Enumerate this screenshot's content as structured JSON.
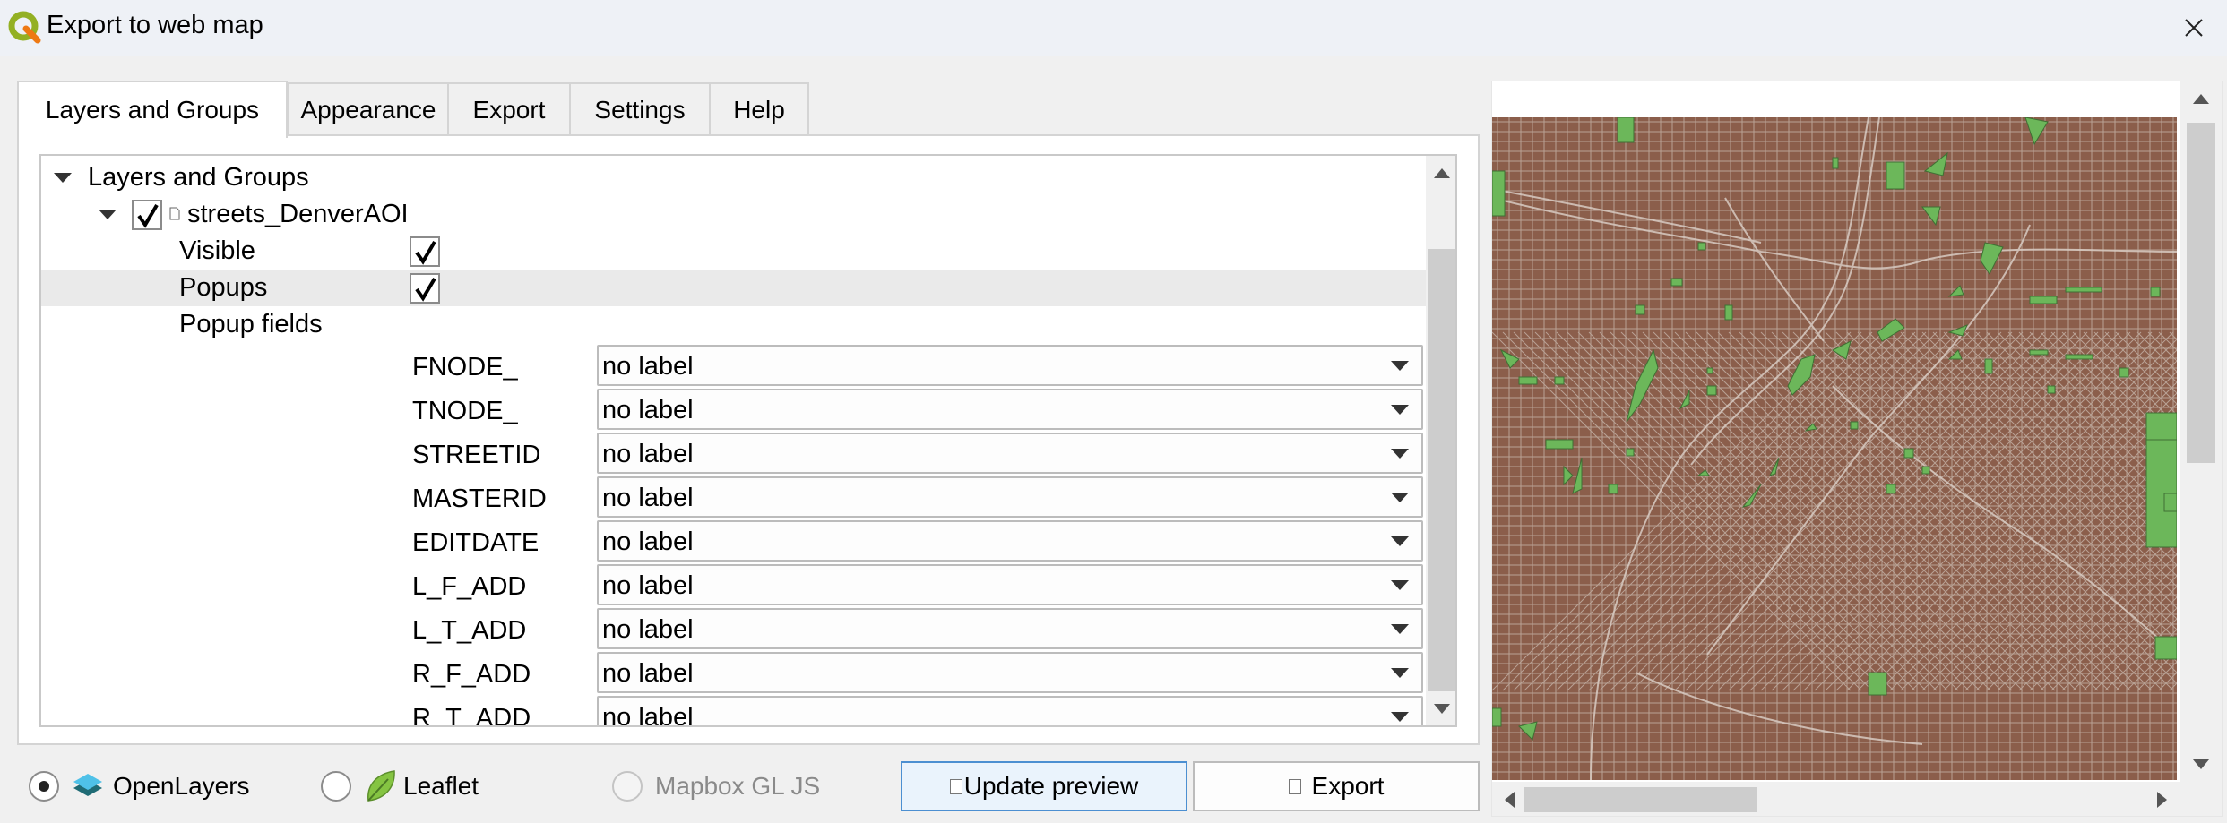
{
  "window": {
    "title": "Export to web map"
  },
  "colors": {
    "accent": "#4c8fd1",
    "map_background": "#8b5e4b",
    "map_parks": "#6cb75a",
    "map_streets": "#c9b9ae"
  },
  "tabs": [
    {
      "label": "Layers and Groups",
      "active": true
    },
    {
      "label": "Appearance",
      "active": false
    },
    {
      "label": "Export",
      "active": false
    },
    {
      "label": "Settings",
      "active": false
    },
    {
      "label": "Help",
      "active": false
    }
  ],
  "tree": {
    "root_label": "Layers and Groups",
    "layer": {
      "name": "streets_DenverAOI",
      "checked": true,
      "visible_label": "Visible",
      "visible_checked": true,
      "popups_label": "Popups",
      "popups_checked": true,
      "popup_fields_label": "Popup fields",
      "fields": [
        {
          "name": "FNODE_",
          "value": "no label"
        },
        {
          "name": "TNODE_",
          "value": "no label"
        },
        {
          "name": "STREETID",
          "value": "no label"
        },
        {
          "name": "MASTERID",
          "value": "no label"
        },
        {
          "name": "EDITDATE",
          "value": "no label"
        },
        {
          "name": "L_F_ADD",
          "value": "no label"
        },
        {
          "name": "L_T_ADD",
          "value": "no label"
        },
        {
          "name": "R_F_ADD",
          "value": "no label"
        },
        {
          "name": "R_T_ADD",
          "value": "no label"
        }
      ]
    }
  },
  "format_options": [
    {
      "label": "OpenLayers",
      "selected": true,
      "enabled": true,
      "icon": "openlayers-icon"
    },
    {
      "label": "Leaflet",
      "selected": false,
      "enabled": true,
      "icon": "leaflet-icon"
    },
    {
      "label": "Mapbox GL JS",
      "selected": false,
      "enabled": false
    }
  ],
  "buttons": {
    "update_preview": "Update preview",
    "export": "Export"
  }
}
